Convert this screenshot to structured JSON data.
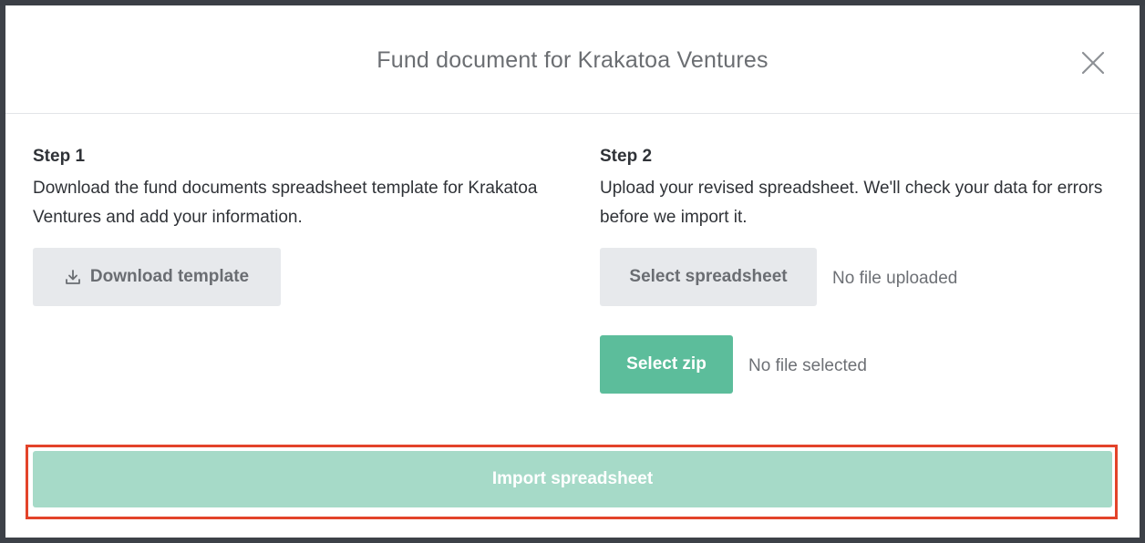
{
  "modal": {
    "title": "Fund document for Krakatoa Ventures"
  },
  "step1": {
    "title": "Step 1",
    "description": "Download the fund documents spreadsheet template for Krakatoa Ventures and add your information.",
    "download_button": "Download template"
  },
  "step2": {
    "title": "Step 2",
    "description": "Upload your revised spreadsheet. We'll check your data for errors before we import it.",
    "select_spreadsheet_button": "Select spreadsheet",
    "spreadsheet_status": "No file uploaded",
    "select_zip_button": "Select zip",
    "zip_status": "No file selected"
  },
  "footer": {
    "import_button": "Import spreadsheet"
  },
  "colors": {
    "primary_green": "#5cbd9b",
    "disabled_green": "#a6dac8",
    "highlight_red": "#e3432a"
  },
  "icons": {
    "close": "close-icon",
    "download": "download-icon"
  }
}
